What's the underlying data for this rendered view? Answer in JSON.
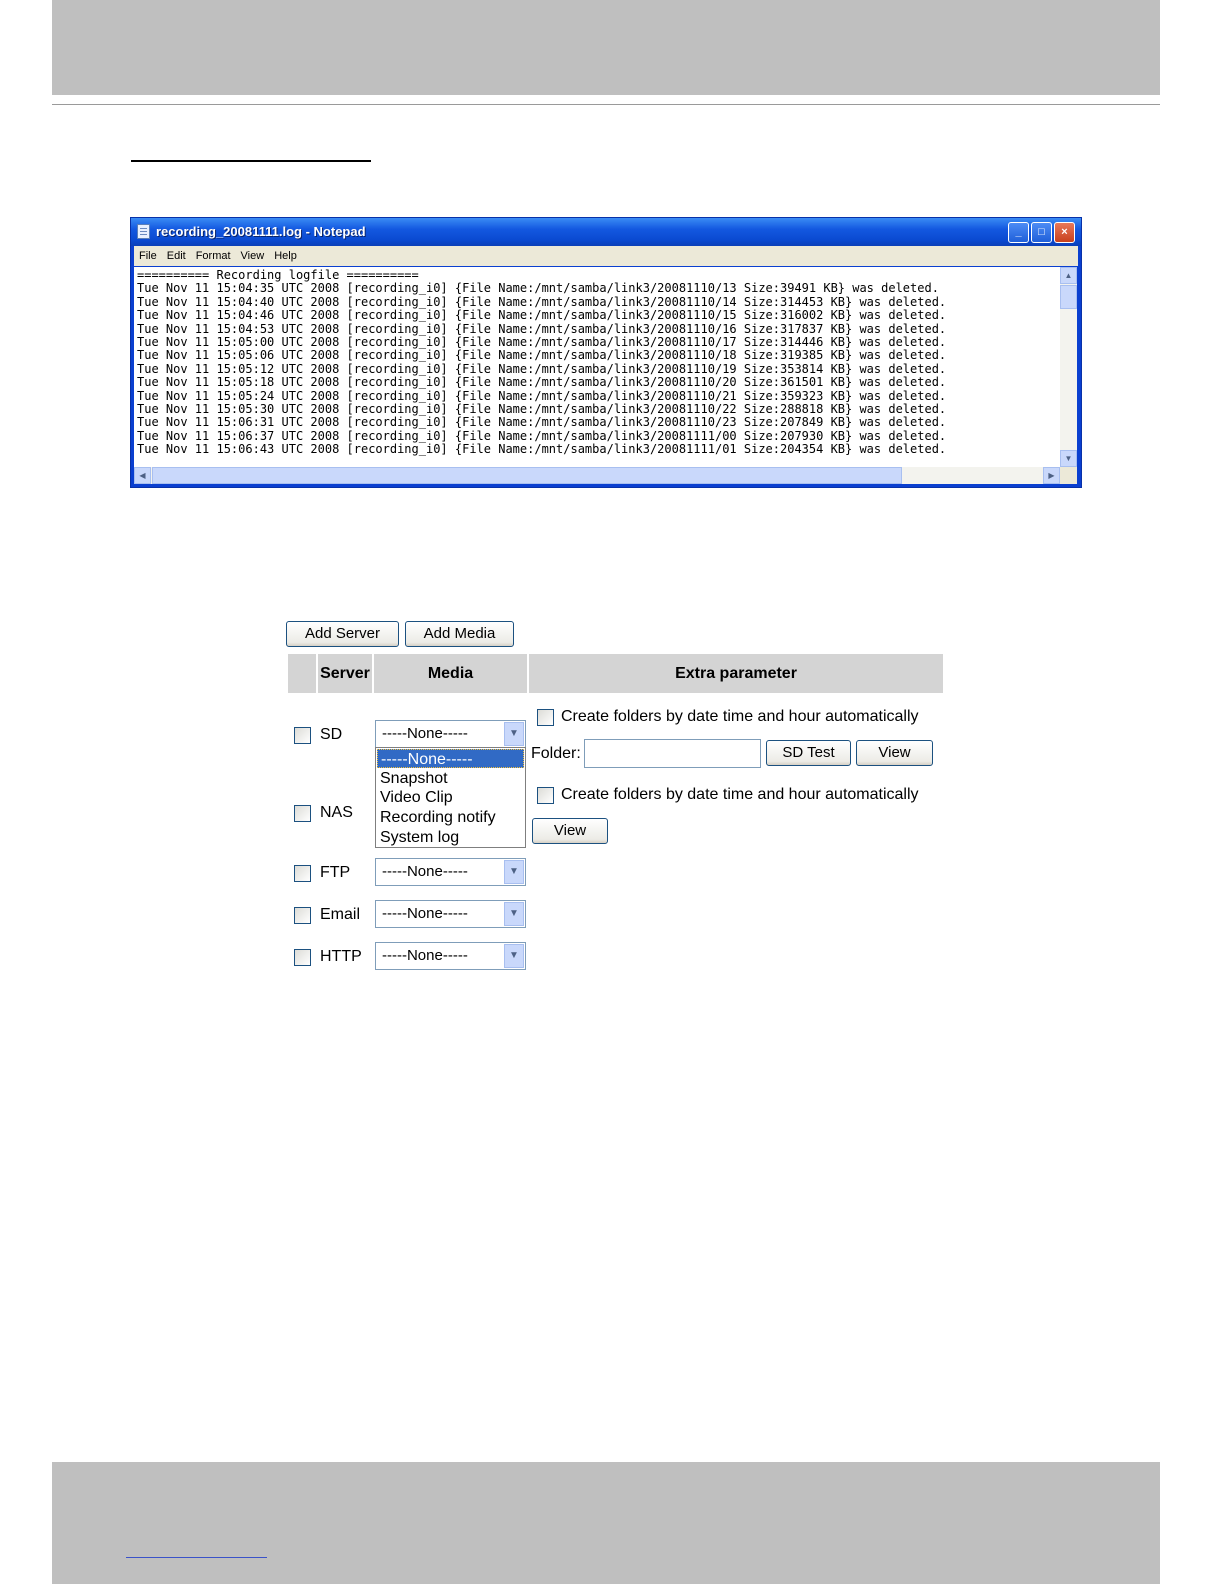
{
  "notepad": {
    "title": "recording_20081111.log - Notepad",
    "menu": [
      "File",
      "Edit",
      "Format",
      "View",
      "Help"
    ],
    "lines": [
      "========== Recording logfile ==========",
      "Tue Nov 11 15:04:35 UTC 2008 [recording_i0] {File Name:/mnt/samba/link3/20081110/13 Size:39491 KB} was deleted.",
      "Tue Nov 11 15:04:40 UTC 2008 [recording_i0] {File Name:/mnt/samba/link3/20081110/14 Size:314453 KB} was deleted.",
      "Tue Nov 11 15:04:46 UTC 2008 [recording_i0] {File Name:/mnt/samba/link3/20081110/15 Size:316002 KB} was deleted.",
      "Tue Nov 11 15:04:53 UTC 2008 [recording_i0] {File Name:/mnt/samba/link3/20081110/16 Size:317837 KB} was deleted.",
      "Tue Nov 11 15:05:00 UTC 2008 [recording_i0] {File Name:/mnt/samba/link3/20081110/17 Size:314446 KB} was deleted.",
      "Tue Nov 11 15:05:06 UTC 2008 [recording_i0] {File Name:/mnt/samba/link3/20081110/18 Size:319385 KB} was deleted.",
      "Tue Nov 11 15:05:12 UTC 2008 [recording_i0] {File Name:/mnt/samba/link3/20081110/19 Size:353814 KB} was deleted.",
      "Tue Nov 11 15:05:18 UTC 2008 [recording_i0] {File Name:/mnt/samba/link3/20081110/20 Size:361501 KB} was deleted.",
      "Tue Nov 11 15:05:24 UTC 2008 [recording_i0] {File Name:/mnt/samba/link3/20081110/21 Size:359323 KB} was deleted.",
      "Tue Nov 11 15:05:30 UTC 2008 [recording_i0] {File Name:/mnt/samba/link3/20081110/22 Size:288818 KB} was deleted.",
      "Tue Nov 11 15:06:31 UTC 2008 [recording_i0] {File Name:/mnt/samba/link3/20081110/23 Size:207849 KB} was deleted.",
      "Tue Nov 11 15:06:37 UTC 2008 [recording_i0] {File Name:/mnt/samba/link3/20081111/00 Size:207930 KB} was deleted.",
      "Tue Nov 11 15:06:43 UTC 2008 [recording_i0] {File Name:/mnt/samba/link3/20081111/01 Size:204354 KB} was deleted."
    ]
  },
  "form": {
    "add_server_label": "Add Server",
    "add_media_label": "Add Media",
    "headers": {
      "server": "Server",
      "media": "Media",
      "extra": "Extra parameter"
    },
    "servers": {
      "sd": "SD",
      "nas": "NAS",
      "ftp": "FTP",
      "email": "Email",
      "http": "HTTP"
    },
    "media_selected": "-----None-----",
    "media_options": [
      "-----None-----",
      "Snapshot",
      "Video Clip",
      "Recording notify",
      "System log"
    ],
    "create_folders_label": "Create folders by date time and hour automatically",
    "folder_label": "Folder:",
    "folder_value": "",
    "sd_test_label": "SD Test",
    "view_label": "View"
  }
}
